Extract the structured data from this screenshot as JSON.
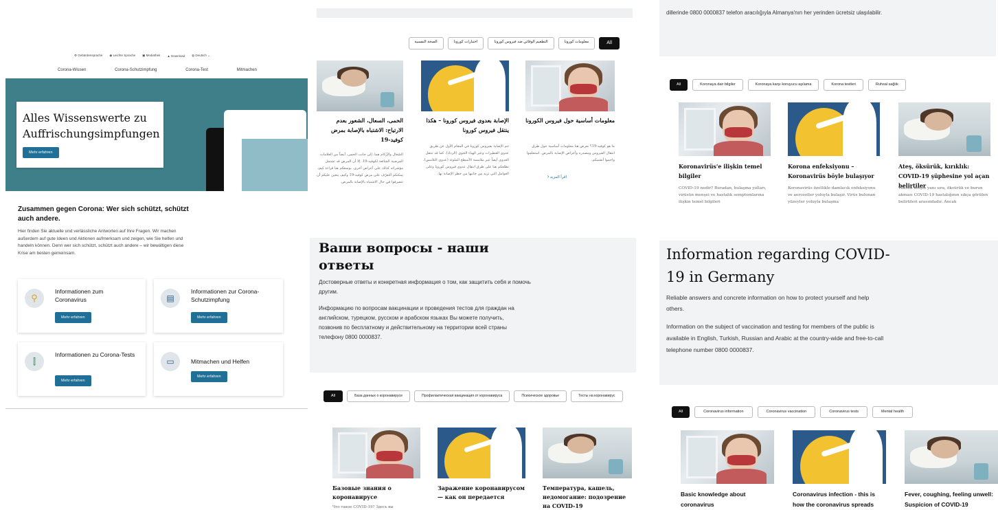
{
  "de": {
    "util": [
      {
        "icon": "gear-icon",
        "label": "Gebärdensprache"
      },
      {
        "icon": "accessibility-icon",
        "label": "Leichte Sprache"
      },
      {
        "icon": "video-icon",
        "label": "Mediathek"
      },
      {
        "icon": "download-icon",
        "label": "Download"
      },
      {
        "icon": "globe-icon",
        "label": "Deutsch"
      }
    ],
    "nav": [
      "Corona-Wissen",
      "Corona-Schutzimpfung",
      "Corona-Test",
      "Mitmachen"
    ],
    "hero_title": "Alles Wissenswerte zu Auffrischungsimpfungen",
    "hero_button": "Mehr erfahren",
    "intro_title": "Zusammen gegen Corona: Wer sich schützt, schützt auch andere.",
    "intro_text": "Hier finden Sie aktuelle und verlässliche Antworten auf Ihre Fragen. Wir machen außerdem auf gute Ideen und Aktionen aufmerksam und zeigen, wie Sie helfen und handeln können. Denn wer sich schützt, schützt auch andere – wir bewältigen diese Krise am besten gemeinsam.",
    "cards": [
      {
        "icon": "virus-search-icon",
        "title": "Informationen zum Coronavirus",
        "button": "Mehr erfahren"
      },
      {
        "icon": "syringe-icon",
        "title": "Informationen zur Corona-Schutzimpfung",
        "button": "Mehr erfahren"
      },
      {
        "icon": "test-tube-icon",
        "title": "Informationen zu Corona-Tests",
        "button": "Mehr erfahren"
      },
      {
        "icon": "laptop-icon",
        "title": "Mitmachen und Helfen",
        "button": "Mehr erfahren"
      }
    ]
  },
  "ar": {
    "chips": [
      "All",
      "معلومات كورونا",
      "التطعيم الوقائي ضد فيروس كورونا",
      "اختبارات كورونا",
      "الصحة النفسية"
    ],
    "cards": [
      {
        "title": "معلومات أساسية حول فيروس الكورونا",
        "text": "ما هو كوفيد-19؟ نعرض هنا معلومات أساسية حول طرق انتقال الفيروس ومصدره وأعراض الإصابة بالمرض. استعلموا واحموا أنفسكم.",
        "link": "اقرأ المزيد"
      },
      {
        "title": "الإصابة بعدوى فيروس كورونا – هكذا ينتقل فيروس كورونا",
        "text": "تتم الإصابة بفيروس كورونا في المقام الأول عن طريق عدوى القطيرات وعبر الهباء الجوي (الرذاذ). كما قد تنتقل العدوى أيضاً عبر ملامسة الأسطح الملوثة (عدوى التلامس). نطلعكم هنا على طرق انتقال عدوى فيروس كورونا وعلى العوامل التي تزيد من جانبها من خطر الإصابة بها."
      },
      {
        "title": "الحمى، السعال، الشعور بعدم الارتياح: الاشتباه بالإصابة بمرض كوفيد-19",
        "text": "السُعال والزُكام هما، إلى جانب الحمى، أيضاً من العلامات المرضية الشائعة لكوفيد-19. إلا أن المرض قد تشتمل مؤشراته كذلك على أعراض أخرى. بوسعكم هنا قراءة كيف يمكنكم التعرّف على مرض كوفيد-19 وكيف يتعين عليكم أن تتصرفوا في حال الاشتباه بالإصابة بالمرض."
      }
    ]
  },
  "tr": {
    "top_text": "dillerinde 0800 0000837 telefon aracılığıyla Almanya'nın her yerinden ücretsiz ulaşılabilir.",
    "chips": [
      "All",
      "Koronaya dair bilgiler",
      "Koronaya karşı koruyucu aşılama",
      "Korona testleri",
      "Ruhsal sağlık"
    ],
    "cards": [
      {
        "title": "Koronavirüs'e ilişkin temel bilgiler",
        "text": "COVID-19 nedir? Buradan, bulaşma yolları, virüsün menşei ve hastalık semptomlarına ilişkin temel bilgileri"
      },
      {
        "title": "Korona enfeksiyonu – Koronavirüs böyle bulaşıyor",
        "text": "Koronavirüs özellikle damlacık enfeksiyonu ve aerosoller yoluyla bulaşır. Virüs bulunan yüzeyler yoluyla bulaşma"
      },
      {
        "title": "Ateş, öksürük, kırıklık: COVID-19 şüphesine yol açan belirtiler",
        "text": "Yüksek ateşin yanı sıra, öksürük ve burun akması COVID-19 hastalığının sıkça görülen belirtileri arasındadır. Ancak"
      }
    ]
  },
  "ru": {
    "title": "Ваши вопросы - наши ответы",
    "p1": "Достоверные ответы и конкретная информация о том, как защитить себя и помочь другим.",
    "p2": "Информацию по вопросам вакцинации и проведения тестов для граждан на английском, турецком, русском и арабском языках Вы можете получить, позвонив по бесплатному и действительному на территории всей страны телефону 0800 0000837.",
    "chips": [
      "All",
      "База данных о коронавирусе",
      "Профилактическая вакцинация от коронавируса",
      "Психическое здоровье",
      "Тесты на коронавирус"
    ],
    "cards": [
      {
        "title": "Базовые знания о коронавирусе",
        "text": "Что такое COVID-19? Здесь вы"
      },
      {
        "title": "Заражение коронавирусом — как он передается"
      },
      {
        "title": "Температура, кашель, недомогание: подозрение на COVID-19"
      }
    ]
  },
  "en": {
    "title": "Information regarding COVID-19 in Germany",
    "p1": "Reliable answers and concrete information on how to protect yourself and help others.",
    "p2": "Information on the subject of vaccination and testing for members of the public is available in English, Turkish, Russian and Arabic at the country-wide and free-to-call telephone number 0800 0000837.",
    "chips": [
      "All",
      "Coronavirus information",
      "Coronavirus vaccination",
      "Coronavirus tests",
      "Mental health"
    ],
    "cards": [
      {
        "title": "Basic knowledge about coronavirus"
      },
      {
        "title": "Coronavirus infection - this is how the coronavirus spreads"
      },
      {
        "title": "Fever, coughing, feeling unwell: Suspicion of COVID-19"
      }
    ]
  },
  "colors": {
    "teal": "#3e7f8a",
    "button_blue": "#1f6f97",
    "panel_gray": "#f2f3f4"
  }
}
